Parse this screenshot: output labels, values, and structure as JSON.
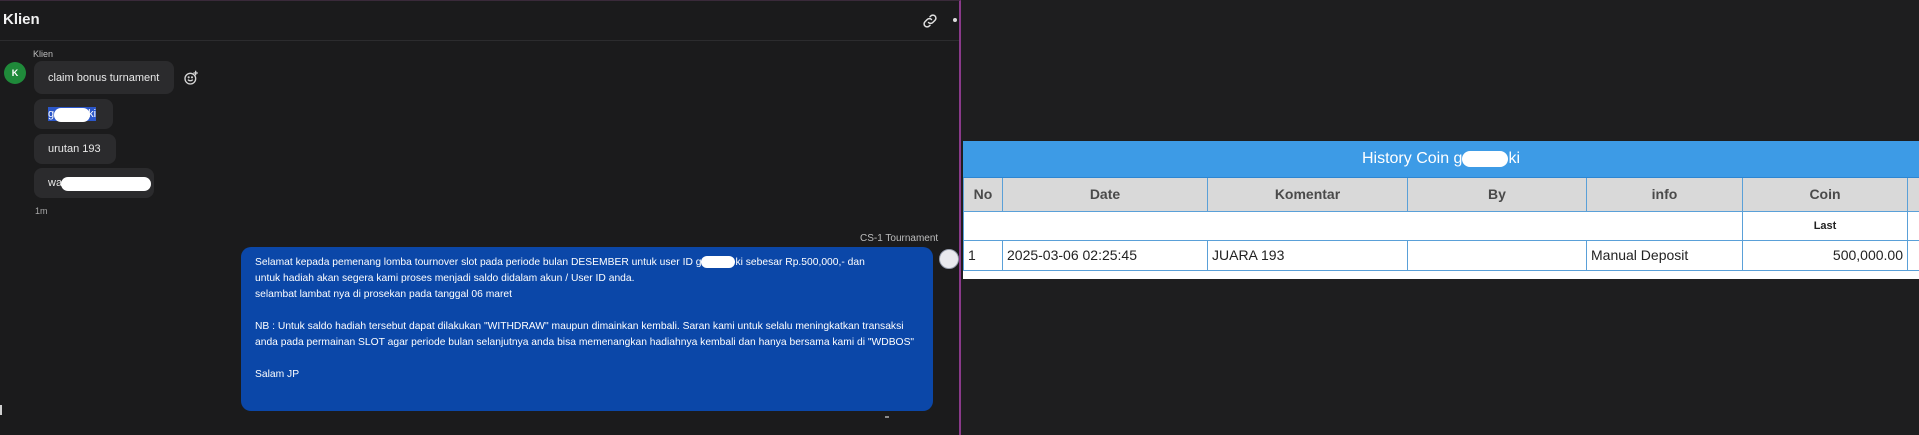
{
  "chat": {
    "title": "Klien",
    "header_icons": [
      "link-icon",
      "more-icon"
    ],
    "sender_name": "Klien",
    "avatar_initial": "K",
    "messages": [
      {
        "text": "claim bonus turnament"
      },
      {
        "prefix": "g",
        "suffix": "ki"
      },
      {
        "text": "urutan 193"
      },
      {
        "prefix": "wa",
        "suffix": ""
      }
    ],
    "time_ago": "1m",
    "agent_name": "CS-1 Tournament",
    "agent_message": {
      "line1_before": "Selamat kepada pemenang lomba tournover slot pada periode bulan DESEMBER untuk user ID g",
      "line1_after": "ki sebesar Rp.500,000,- dan",
      "line2": "untuk hadiah akan segera kami proses menjadi saldo didalam akun / User ID anda.",
      "line3": "selambat lambat nya di prosekan pada tanggal 06 maret",
      "para2": "NB : Untuk saldo hadiah tersebut dapat dilakukan \"WITHDRAW\" maupun dimainkan kembali. Saran kami untuk selalu meningkatkan transaksi anda pada permainan SLOT agar periode bulan selanjutnya anda bisa memenangkan hadiahnya kembali dan hanya bersama kami di \"WDBOS\"",
      "signoff": "Salam JP"
    }
  },
  "history": {
    "title_prefix": "History Coin g",
    "title_suffix": "ki",
    "columns": [
      "No",
      "Date",
      "Komentar",
      "By",
      "info",
      "Coin"
    ],
    "summary_label": "Last",
    "rows": [
      {
        "no": "1",
        "date": "2025-03-06 02:25:45",
        "komentar": "JUARA 193",
        "by": "",
        "info": "Manual Deposit",
        "coin": "500,000.00"
      }
    ],
    "colors": {
      "header_bar": "#3d9be6",
      "coin_value": "#2a9a2a"
    }
  }
}
